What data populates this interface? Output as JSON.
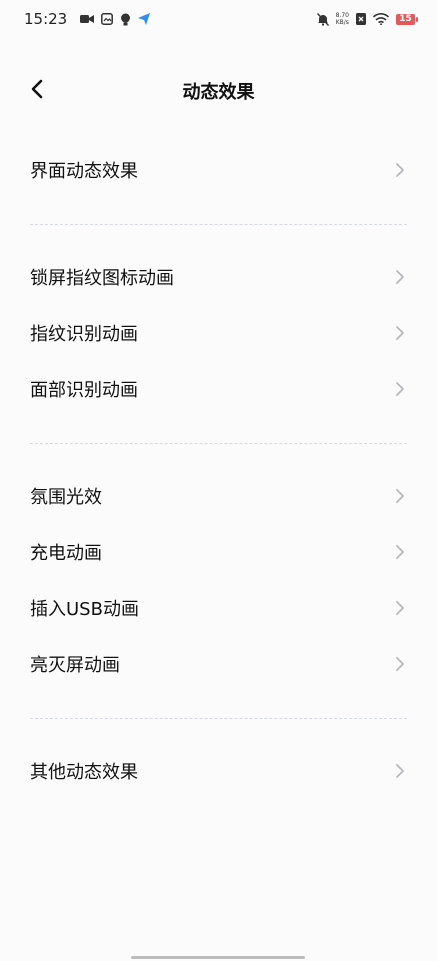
{
  "status_bar": {
    "time": "15:23",
    "net_speed_value": "8.70",
    "net_speed_unit": "KB/s",
    "battery": "15",
    "icons": [
      "video-camera-icon",
      "gallery-icon",
      "bulb-icon",
      "send-icon",
      "mute-icon",
      "close-box-icon",
      "wifi-icon",
      "battery-icon"
    ],
    "battery_color": "#e45a5a"
  },
  "header": {
    "title": "动态效果",
    "back_icon": "chevron-left-icon"
  },
  "sections": [
    {
      "items": [
        {
          "label": "界面动态效果"
        }
      ]
    },
    {
      "items": [
        {
          "label": "锁屏指纹图标动画"
        },
        {
          "label": "指纹识别动画"
        },
        {
          "label": "面部识别动画"
        }
      ]
    },
    {
      "items": [
        {
          "label": "氛围光效"
        },
        {
          "label": "充电动画"
        },
        {
          "label": "插入USB动画"
        },
        {
          "label": "亮灭屏动画"
        }
      ]
    },
    {
      "items": [
        {
          "label": "其他动态效果"
        }
      ]
    }
  ],
  "colors": {
    "background": "#fbfbfb",
    "chevron": "#b8b8bc",
    "divider": "#d8d8e0"
  }
}
